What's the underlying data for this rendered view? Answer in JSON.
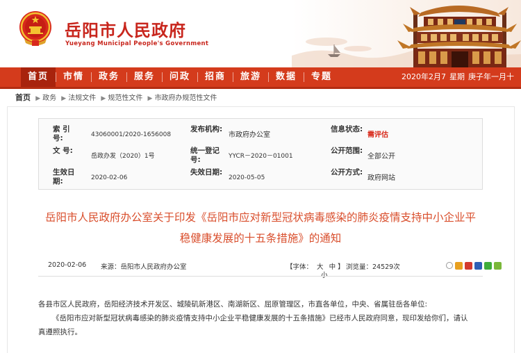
{
  "header": {
    "title": "岳阳市人民政府",
    "subtitle": "Yueyang Municipal People's Government",
    "colors": {
      "brand_red": "#c8261d",
      "nav_red": "#d43b1c",
      "nav_active": "#a8230d"
    }
  },
  "nav": {
    "items": [
      {
        "label": "首页",
        "active": true
      },
      {
        "label": "市情"
      },
      {
        "label": "政务"
      },
      {
        "label": "服务"
      },
      {
        "label": "问政"
      },
      {
        "label": "招商"
      },
      {
        "label": "旅游"
      },
      {
        "label": "数据"
      },
      {
        "label": "专题"
      }
    ],
    "date": "2020年2月7",
    "weekday": "星期",
    "lunar": "庚子年一月十"
  },
  "breadcrumb": {
    "home": "首页",
    "items": [
      "政务",
      "法规文件",
      "规范性文件",
      "市政府办规范性文件"
    ]
  },
  "info": {
    "index_label": "索 引 号:",
    "index_value": "43060001/2020-1656008",
    "publisher_label": "发布机构:",
    "publisher_value": "市政府办公室",
    "status_label": "信息状态:",
    "status_value": "需评估",
    "docno_label": "文 号:",
    "docno_value": "岳政办发（2020）1号",
    "regno_label": "统一登记号:",
    "regno_value": "YYCR－2020－01001",
    "scope_label": "公开范围:",
    "scope_value": "全部公开",
    "effective_label": "生效日期:",
    "effective_value": "2020-02-06",
    "expire_label": "失效日期:",
    "expire_value": "2020-05-05",
    "method_label": "公开方式:",
    "method_value": "政府网站"
  },
  "document": {
    "title_line1": "岳阳市人民政府办公室关于印发《岳阳市应对新型冠状病毒感染的肺炎疫情支持中小企业平",
    "title_line2": "稳健康发展的十五条措施》的通知",
    "date": "2020-02-06",
    "source": "来源：岳阳市人民政府办公室",
    "font_label": "【字体：",
    "font_large": "大",
    "font_medium": "中",
    "font_small": "小",
    "font_close": "】",
    "views": "浏览量：24529次",
    "share_icons": [
      "share-icon",
      "qzone-icon",
      "weibo-icon",
      "baidu-icon",
      "wechat-icon",
      "more-icon"
    ],
    "body_para1": "各县市区人民政府，岳阳经济技术开发区、城陵矶新港区、南湖新区、屈原管理区，市直各单位，中央、省属驻岳各单位:",
    "body_para2": "《岳阳市应对新型冠状病毒感染的肺炎疫情支持中小企业平稳健康发展的十五条措施》已经市人民政府同意，现印发给你们，请认",
    "body_para3": "真遵照执行。"
  }
}
